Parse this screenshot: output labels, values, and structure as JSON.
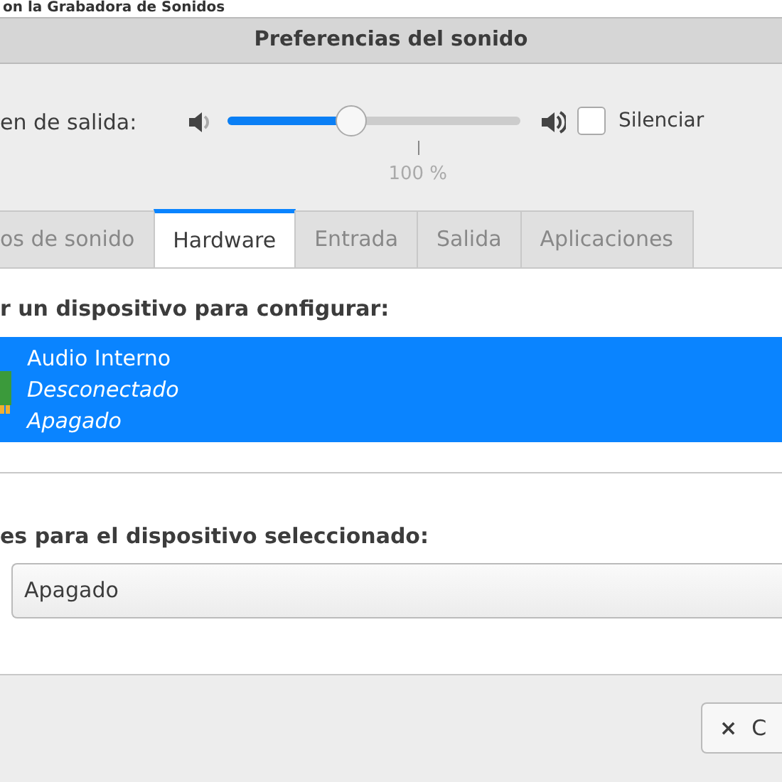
{
  "background_window": {
    "title": "on la Grabadora de Sonidos"
  },
  "window": {
    "title": "Preferencias del sonido"
  },
  "volume": {
    "label": "en de salida:",
    "level": 0.42,
    "mark": "100 %",
    "mute": {
      "label": "Silenciar",
      "checked": false
    }
  },
  "tabs": [
    {
      "label": "os de sonido",
      "selected": false
    },
    {
      "label": "Hardware",
      "selected": true
    },
    {
      "label": "Entrada",
      "selected": false
    },
    {
      "label": "Salida",
      "selected": false
    },
    {
      "label": "Aplicaciones",
      "selected": false
    }
  ],
  "devices": {
    "heading": "r un dispositivo para configurar:",
    "items": [
      {
        "name": "Audio Interno",
        "status": "Desconectado",
        "profile": "Apagado",
        "selected": true
      }
    ]
  },
  "settings": {
    "heading": "es para el dispositivo seleccionado:",
    "profile": "Apagado"
  },
  "buttons": [
    {
      "icon": "×",
      "label": "C"
    }
  ]
}
